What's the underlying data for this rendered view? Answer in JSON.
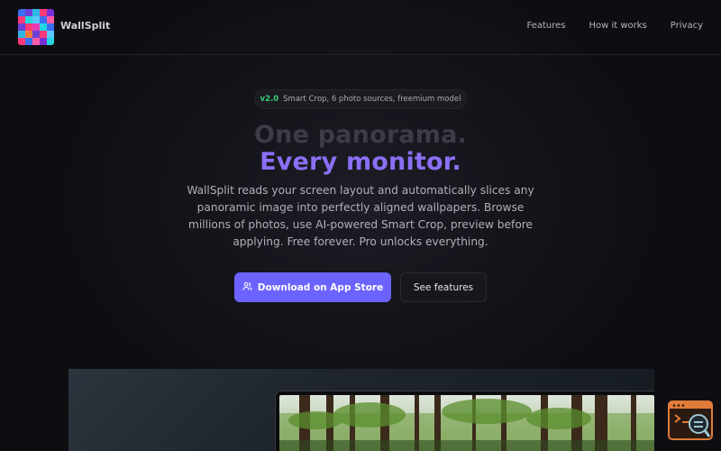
{
  "app": {
    "name": "WallSplit"
  },
  "nav": {
    "items": [
      {
        "label": "Features"
      },
      {
        "label": "How it works"
      },
      {
        "label": "Privacy"
      }
    ]
  },
  "badge": {
    "version": "v2.0",
    "text": "Smart Crop, 6 photo sources, freemium model"
  },
  "hero": {
    "title_line1": "One panorama.",
    "title_line2": "Every monitor.",
    "description": "WallSplit reads your screen layout and automatically slices any panoramic image into perfectly aligned wallpapers. Browse millions of photos, use AI-powered Smart Crop, preview before applying. Free forever. Pro unlocks everything."
  },
  "buttons": {
    "primary_label": "Download on App Store",
    "primary_icon": "users-icon",
    "secondary_label": "See features"
  },
  "colors": {
    "accent": "#6c63ff",
    "title_gradient_end": "#8b6ff5",
    "badge_version": "#34d17a",
    "widget_border": "#e07b39"
  }
}
